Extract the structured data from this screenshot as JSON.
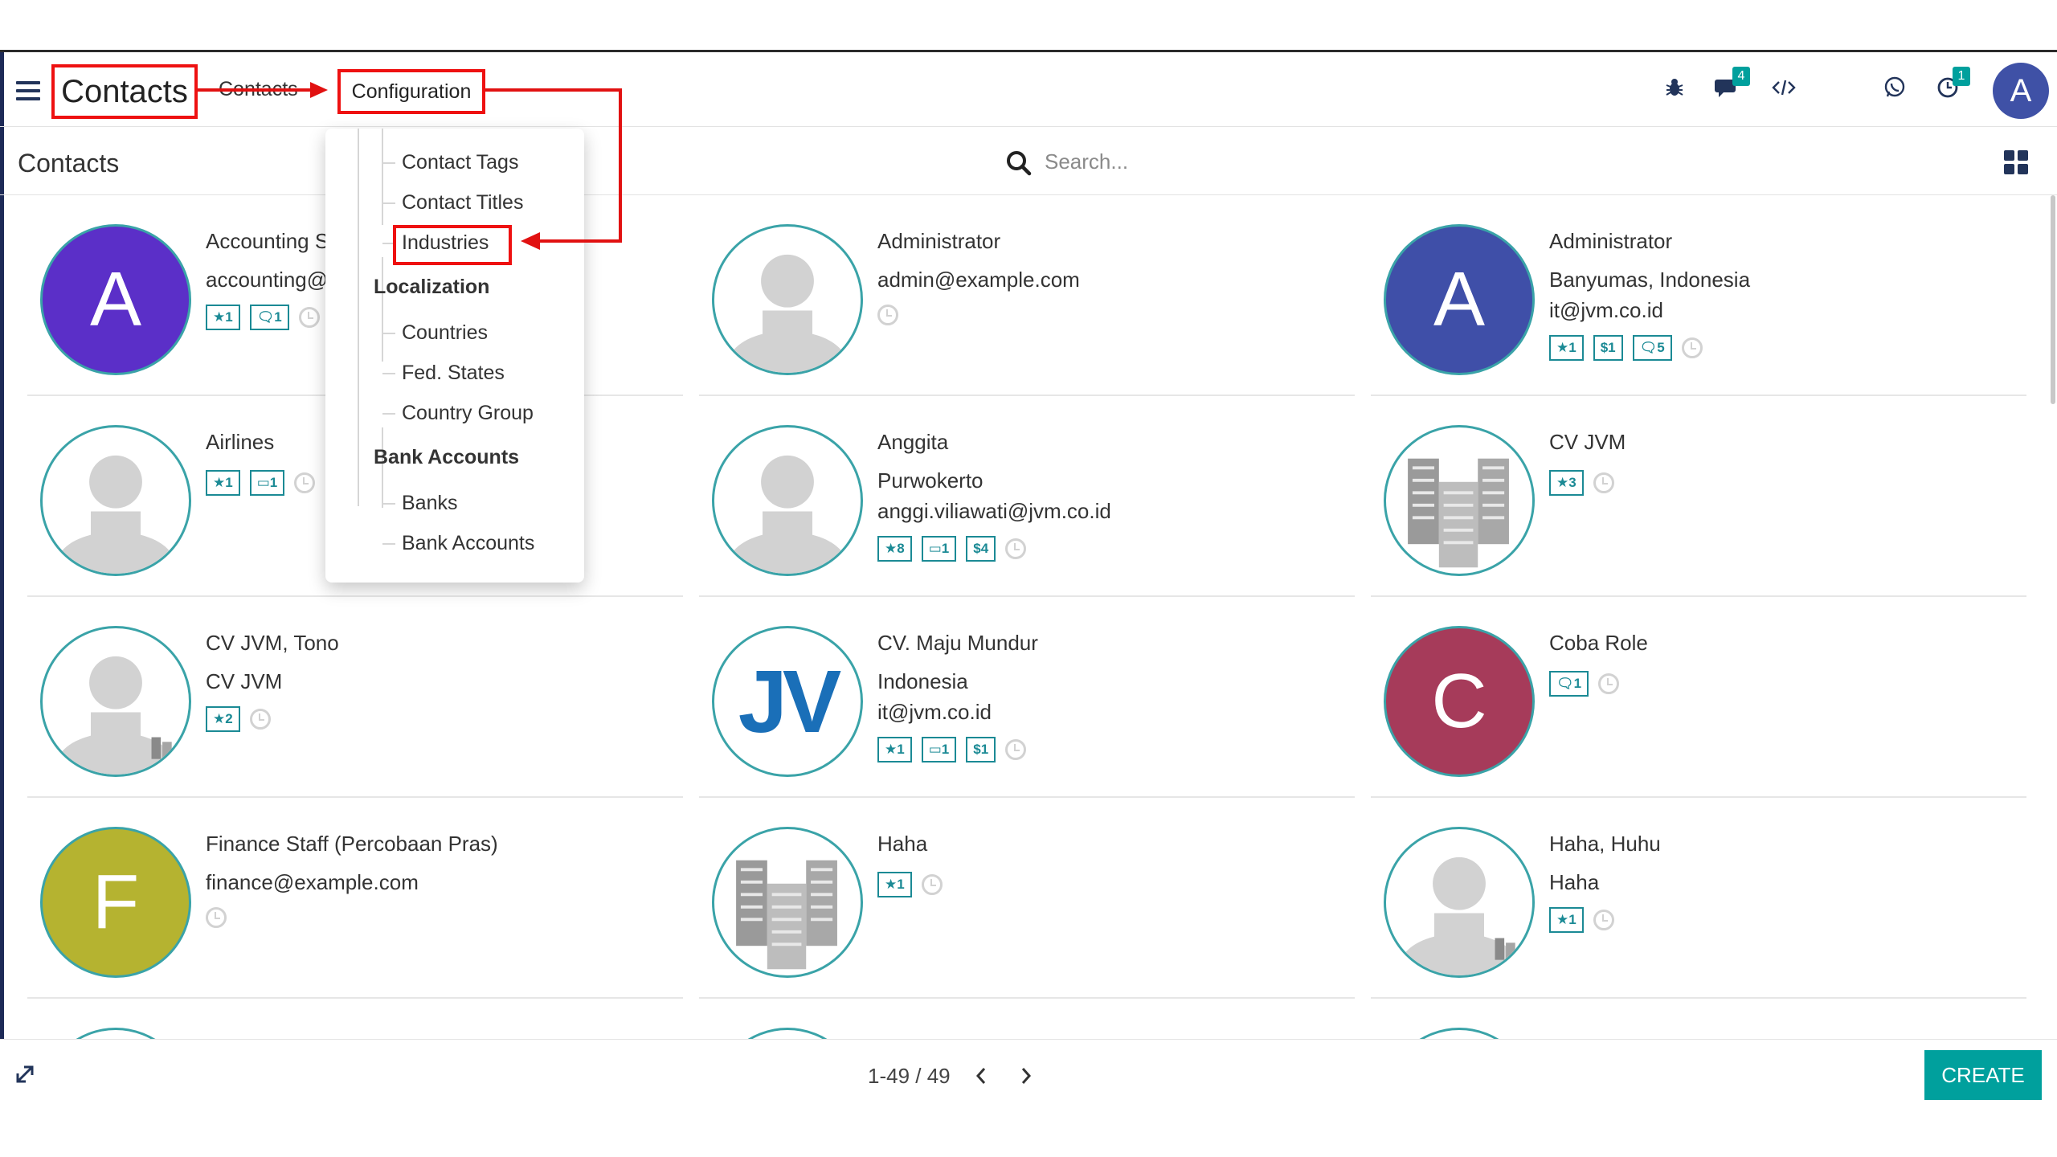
{
  "navbar": {
    "app_title": "Contacts",
    "menu_contacts": "Contacts",
    "menu_configuration": "Configuration",
    "messages_count": "4",
    "activities_count": "1",
    "user_initial": "A"
  },
  "control": {
    "title": "Contacts",
    "search_placeholder": "Search..."
  },
  "config_menu": {
    "items_top": [
      "Contact Tags",
      "Contact Titles",
      "Industries"
    ],
    "section_localization": "Localization",
    "items_localization": [
      "Countries",
      "Fed. States",
      "Country Group"
    ],
    "section_bank": "Bank Accounts",
    "items_bank": [
      "Banks",
      "Bank Accounts"
    ]
  },
  "cards": [
    {
      "name": "Accounting S",
      "line1": "accounting@",
      "line2": "",
      "avatar": "A",
      "color": "#5b2fc8",
      "tags": [
        "★1",
        "🗨1"
      ]
    },
    {
      "name": "Administrator",
      "line1": "admin@example.com",
      "line2": "",
      "avatar": "",
      "color": "",
      "tags": []
    },
    {
      "name": "Administrator",
      "line1": "Banyumas, Indonesia",
      "line2": "it@jvm.co.id",
      "avatar": "A",
      "color": "#3f4fa8",
      "tags": [
        "★1",
        "$1",
        "🗨5"
      ]
    },
    {
      "name": "Airlines",
      "line1": "",
      "line2": "",
      "avatar": "",
      "color": "",
      "tags": [
        "★1",
        "▭1"
      ]
    },
    {
      "name": "Anggita",
      "line1": "Purwokerto",
      "line2": "anggi.viliawati@jvm.co.id",
      "avatar": "",
      "color": "",
      "tags": [
        "★8",
        "▭1",
        "$4"
      ]
    },
    {
      "name": "CV JVM",
      "line1": "",
      "line2": "",
      "avatar": "building",
      "color": "",
      "tags": [
        "★3"
      ]
    },
    {
      "name": "CV JVM, Tono",
      "line1": "CV JVM",
      "line2": "",
      "avatar": "",
      "color": "",
      "tags": [
        "★2"
      ]
    },
    {
      "name": "CV. Maju Mundur",
      "line1": "Indonesia",
      "line2": "it@jvm.co.id",
      "avatar": "JV",
      "color": "",
      "tags": [
        "★1",
        "▭1",
        "$1"
      ]
    },
    {
      "name": "Coba Role",
      "line1": "",
      "line2": "",
      "avatar": "C",
      "color": "#a63b5a",
      "tags": [
        "🗨1"
      ]
    },
    {
      "name": "Finance Staff (Percobaan Pras)",
      "line1": "finance@example.com",
      "line2": "",
      "avatar": "F",
      "color": "#b5b330",
      "tags": []
    },
    {
      "name": "Haha",
      "line1": "",
      "line2": "",
      "avatar": "building",
      "color": "",
      "tags": [
        "★1"
      ]
    },
    {
      "name": "Haha, Huhu",
      "line1": "Haha",
      "line2": "",
      "avatar": "",
      "color": "",
      "tags": [
        "★1"
      ]
    }
  ],
  "footer": {
    "pager": "1-49 / 49",
    "create_label": "CREATE"
  },
  "colors": {
    "accent": "#00a09d",
    "annotation": "#e11111",
    "tag": "#1b8a95"
  }
}
